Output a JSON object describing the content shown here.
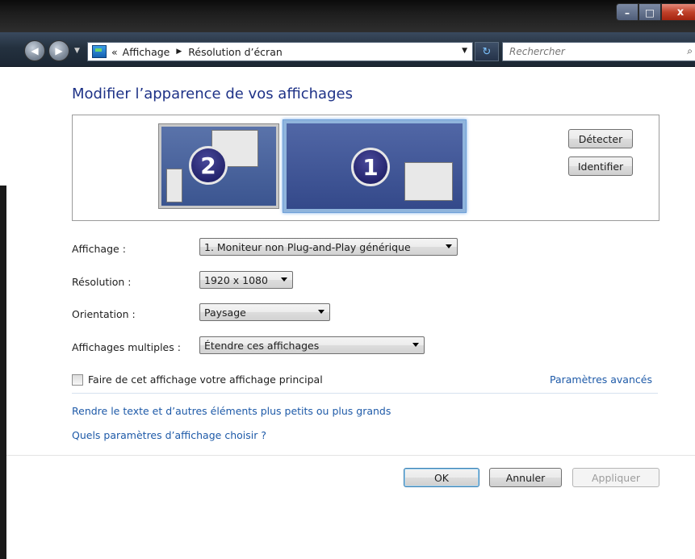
{
  "window": {
    "buttons": {
      "minimize": "–",
      "maximize": "□",
      "close": "x"
    }
  },
  "nav": {
    "breadcrumb_prefix": "«",
    "crumbs": [
      "Affichage",
      "Résolution d’écran"
    ],
    "search_placeholder": "Rechercher"
  },
  "page": {
    "title": "Modifier l’apparence de vos affichages",
    "preview": {
      "monitor_2_number": "2",
      "monitor_1_number": "1",
      "detect_label": "Détecter",
      "identify_label": "Identifier"
    },
    "fields": {
      "display_label": "Affichage :",
      "display_value": "1. Moniteur non Plug-and-Play générique",
      "resolution_label": "Résolution :",
      "resolution_value": "1920 x 1080",
      "orientation_label": "Orientation :",
      "orientation_value": "Paysage",
      "multiple_label": "Affichages multiples :",
      "multiple_value": "Étendre ces affichages"
    },
    "main_display_checkbox_label": "Faire de cet affichage votre affichage principal",
    "main_display_checked": false,
    "advanced_link": "Paramètres avancés",
    "links": [
      "Rendre le texte et d’autres éléments plus petits ou plus grands",
      "Quels paramètres d’affichage choisir ?"
    ],
    "buttons": {
      "ok": "OK",
      "cancel": "Annuler",
      "apply": "Appliquer"
    }
  }
}
